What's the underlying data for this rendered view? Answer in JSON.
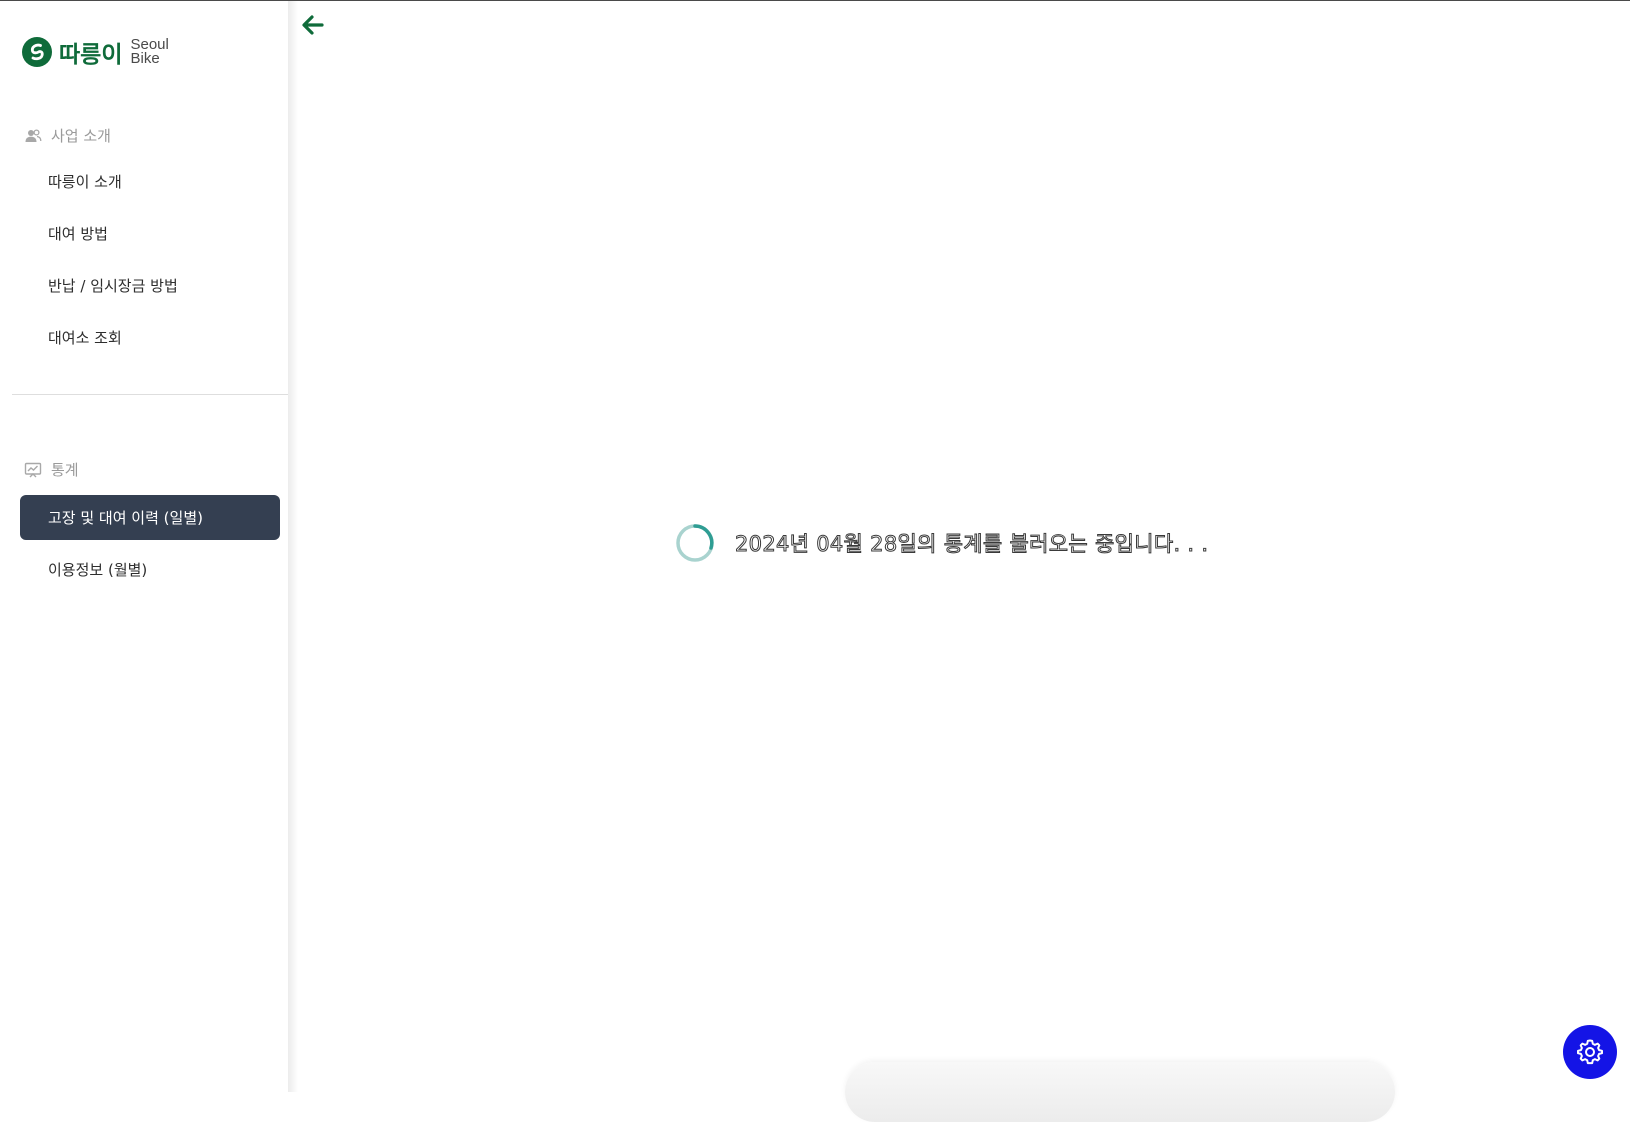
{
  "logo": {
    "korean": "따릉이",
    "english_line1": "Seoul",
    "english_line2": "Bike",
    "brand_color": "#0f6b3a"
  },
  "sidebar": {
    "sections": [
      {
        "label": "사업 소개",
        "icon": "people-icon",
        "items": [
          {
            "label": "따릉이 소개",
            "active": false
          },
          {
            "label": "대여 방법",
            "active": false
          },
          {
            "label": "반납 / 임시장금 방법",
            "active": false
          },
          {
            "label": "대여소 조회",
            "active": false
          }
        ]
      },
      {
        "label": "통계",
        "icon": "chart-board-icon",
        "items": [
          {
            "label": "고장 및 대여 이력 (일별)",
            "active": true
          },
          {
            "label": "이용정보 (월별)",
            "active": false
          }
        ]
      }
    ],
    "active_color": "#343f51"
  },
  "main": {
    "back_icon": "arrow-left-icon",
    "loading_text": "2024년 04월 28일의 통계를 불러오는 중입니다. . ."
  },
  "settings_button": {
    "icon": "gear-icon",
    "color": "#1414e6"
  }
}
